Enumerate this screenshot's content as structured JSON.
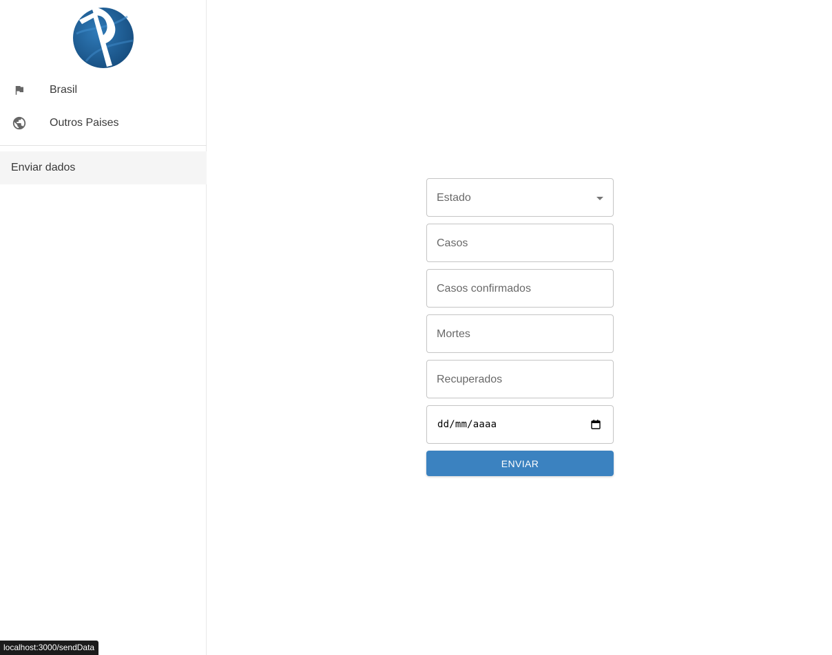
{
  "sidebar": {
    "logo_icon": "brand-logo-icon",
    "items": [
      {
        "label": "Brasil",
        "icon": "flag-icon"
      },
      {
        "label": "Outros Paises",
        "icon": "globe-icon"
      }
    ],
    "send_item": {
      "label": "Enviar dados"
    }
  },
  "form": {
    "estado": {
      "placeholder": "Estado",
      "icon": "arrow-drop-down-icon"
    },
    "casos": {
      "placeholder": "Casos"
    },
    "casos_confirmados": {
      "placeholder": "Casos confirmados"
    },
    "mortes": {
      "placeholder": "Mortes"
    },
    "recuperados": {
      "placeholder": "Recuperados"
    },
    "data": {
      "placeholder": "dd/mm/aaaa",
      "icon": "calendar-icon"
    },
    "submit_label": "ENVIAR"
  },
  "status_bar": {
    "url": "localhost:3000/sendData"
  },
  "colors": {
    "accent": "#3b82c0",
    "logo_blue": "#1f5f96",
    "selected_bg": "#f5f5f5"
  }
}
